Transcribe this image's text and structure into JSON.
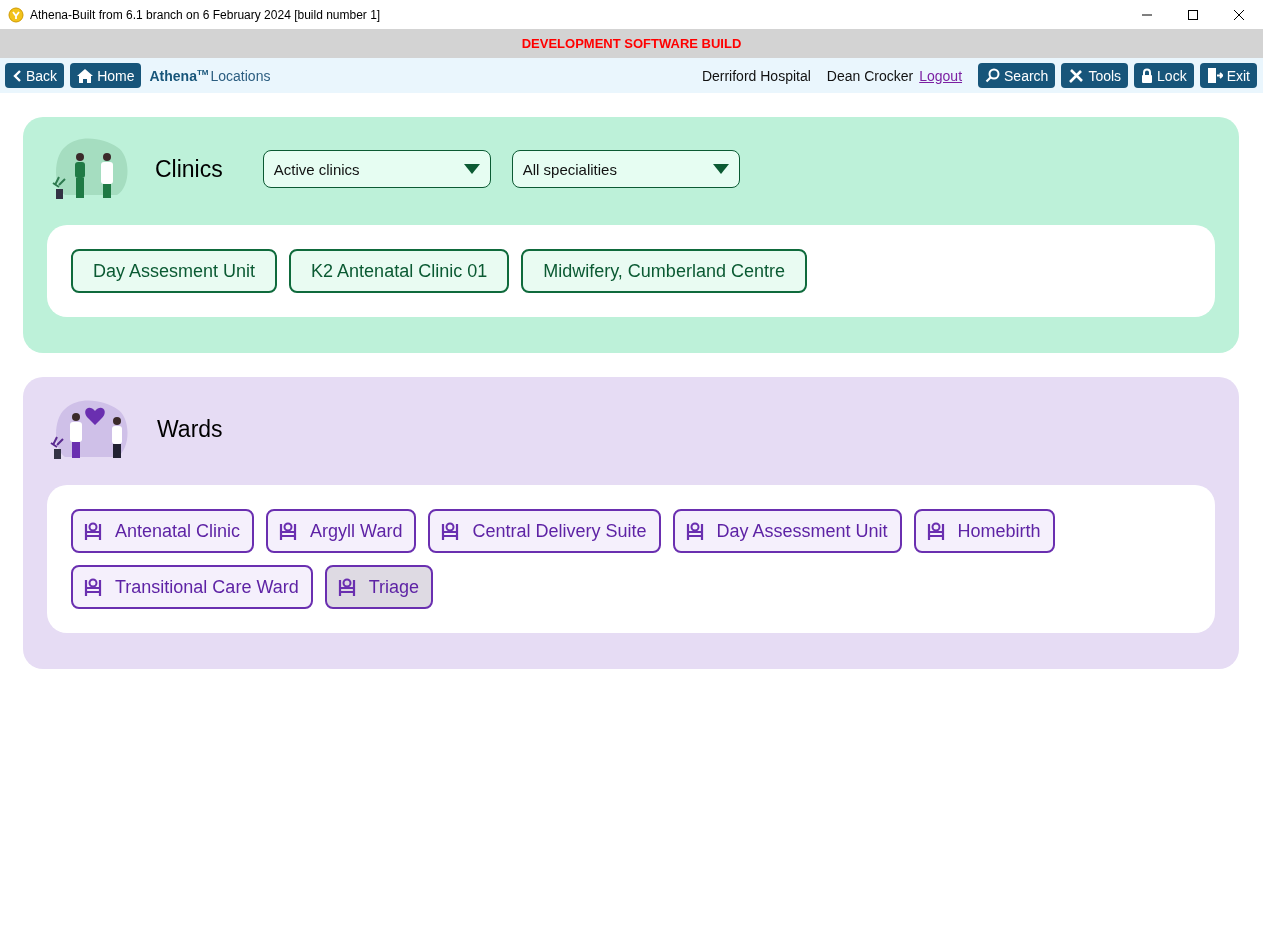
{
  "window": {
    "title": "Athena-Built from 6.1 branch on 6 February 2024 [build number 1]"
  },
  "banner": "DEVELOPMENT SOFTWARE BUILD",
  "toolbar": {
    "back": "Back",
    "home": "Home",
    "brand": "Athena",
    "brand_mark": "TM",
    "page": "Locations",
    "hospital": "Derriford Hospital",
    "user": "Dean Crocker",
    "logout": "Logout",
    "actions": [
      {
        "kind": "search",
        "label": "Search"
      },
      {
        "kind": "tools",
        "label": "Tools"
      },
      {
        "kind": "lock",
        "label": "Lock"
      },
      {
        "kind": "exit",
        "label": "Exit"
      }
    ]
  },
  "clinics": {
    "title": "Clinics",
    "filters": [
      {
        "value": "Active clinics"
      },
      {
        "value": "All specialities"
      }
    ],
    "items": [
      {
        "label": "Day Assesment Unit"
      },
      {
        "label": "K2 Antenatal Clinic 01"
      },
      {
        "label": "Midwifery, Cumberland Centre"
      }
    ]
  },
  "wards": {
    "title": "Wards",
    "items": [
      {
        "label": "Antenatal Clinic",
        "selected": false
      },
      {
        "label": "Argyll Ward",
        "selected": false
      },
      {
        "label": "Central Delivery Suite",
        "selected": false
      },
      {
        "label": "Day Assessment Unit",
        "selected": false
      },
      {
        "label": "Homebirth",
        "selected": false
      },
      {
        "label": "Transitional Care Ward",
        "selected": false
      },
      {
        "label": "Triage",
        "selected": true
      }
    ]
  }
}
